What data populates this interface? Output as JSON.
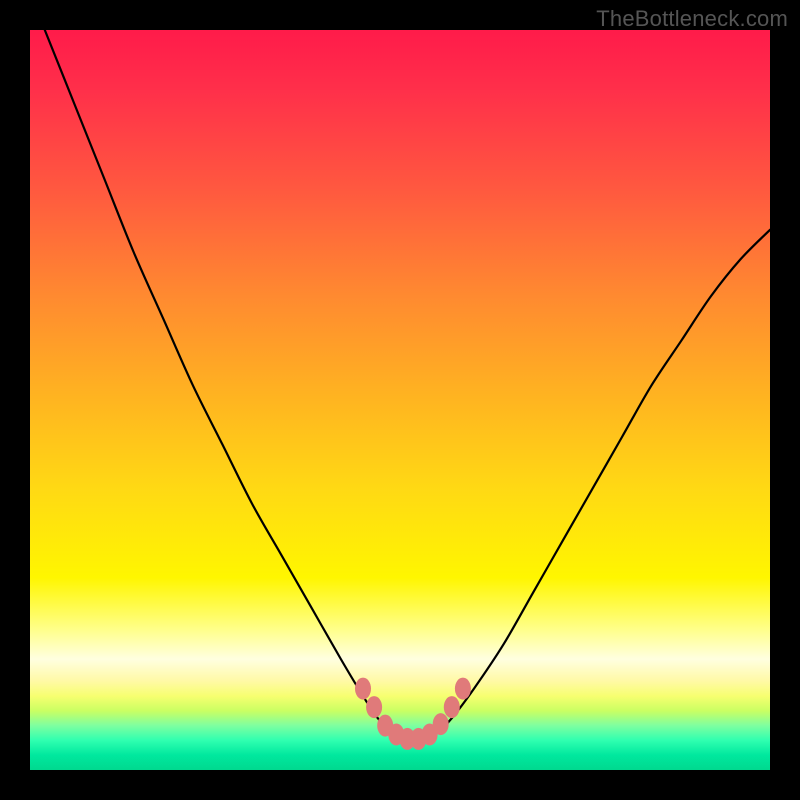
{
  "watermark": "TheBottleneck.com",
  "chart_data": {
    "type": "line",
    "title": "",
    "xlabel": "",
    "ylabel": "",
    "xlim": [
      0,
      100
    ],
    "ylim": [
      0,
      100
    ],
    "grid": false,
    "legend": false,
    "note": "Axes have no tick labels; values are pixel-estimated on a 0–100 scale. y is the vertical position of the black curve from bottom (0) to top (100).",
    "series": [
      {
        "name": "curve",
        "x": [
          2,
          6,
          10,
          14,
          18,
          22,
          26,
          30,
          34,
          38,
          42,
          45,
          47,
          49,
          51,
          53,
          55,
          57,
          60,
          64,
          68,
          72,
          76,
          80,
          84,
          88,
          92,
          96,
          100
        ],
        "y": [
          100,
          90,
          80,
          70,
          61,
          52,
          44,
          36,
          29,
          22,
          15,
          10,
          7,
          5,
          4,
          4,
          5,
          7,
          11,
          17,
          24,
          31,
          38,
          45,
          52,
          58,
          64,
          69,
          73
        ]
      }
    ],
    "markers": {
      "color": "#e07a7a",
      "points_xy": [
        [
          45,
          11
        ],
        [
          46.5,
          8.5
        ],
        [
          48,
          6
        ],
        [
          49.5,
          4.8
        ],
        [
          51,
          4.2
        ],
        [
          52.5,
          4.2
        ],
        [
          54,
          4.8
        ],
        [
          55.5,
          6.2
        ],
        [
          57,
          8.5
        ],
        [
          58.5,
          11
        ]
      ]
    },
    "background_gradient_stops": [
      {
        "pos": 0.0,
        "color": "#ff1b4a"
      },
      {
        "pos": 0.22,
        "color": "#ff5a3f"
      },
      {
        "pos": 0.5,
        "color": "#ffb520"
      },
      {
        "pos": 0.74,
        "color": "#fff600"
      },
      {
        "pos": 0.85,
        "color": "#ffffe0"
      },
      {
        "pos": 0.92,
        "color": "#caff63"
      },
      {
        "pos": 1.0,
        "color": "#00d98f"
      }
    ]
  }
}
